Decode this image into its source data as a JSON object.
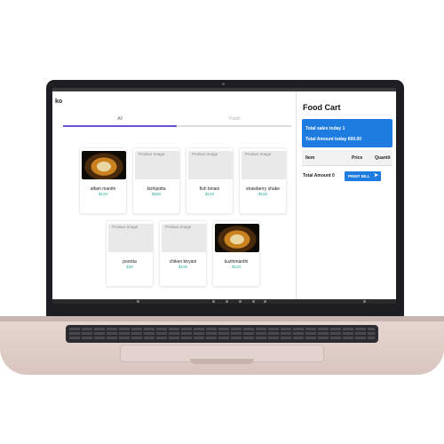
{
  "app": {
    "title": "ko",
    "tabs": [
      {
        "label": "All"
      },
      {
        "label": "Food"
      }
    ]
  },
  "products": [
    {
      "name": "alfam manthi",
      "price": "$120",
      "image_alt": "",
      "has_photo": true
    },
    {
      "name": "kizhipotta",
      "price": "$200",
      "image_alt": "Product Image",
      "has_photo": false
    },
    {
      "name": "fish biriani",
      "price": "$120",
      "image_alt": "Product Image",
      "has_photo": false
    },
    {
      "name": "strawberry shake",
      "price": "$100",
      "image_alt": "Product Image",
      "has_photo": false
    },
    {
      "name": "porotta",
      "price": "$30",
      "image_alt": "Product Image",
      "has_photo": false
    },
    {
      "name": "chiken biryani",
      "price": "$100",
      "image_alt": "Product Image",
      "has_photo": false
    },
    {
      "name": "kuzhimanthi",
      "price": "$120",
      "image_alt": "",
      "has_photo": true
    }
  ],
  "cart": {
    "title": "Food Cart",
    "sales_today": "Total sales today 1",
    "amount_today": "Total Amount today 600.00",
    "columns": [
      "Item",
      "Price",
      "Quantit"
    ],
    "total_label": "Total Amount 0",
    "print_label": "PRINT BILL",
    "print_icon": "send-arrow-icon",
    "accent_color": "#1e7ce0",
    "tab_indicator_color": "#6c4fd8",
    "price_color": "#2aa89a"
  }
}
